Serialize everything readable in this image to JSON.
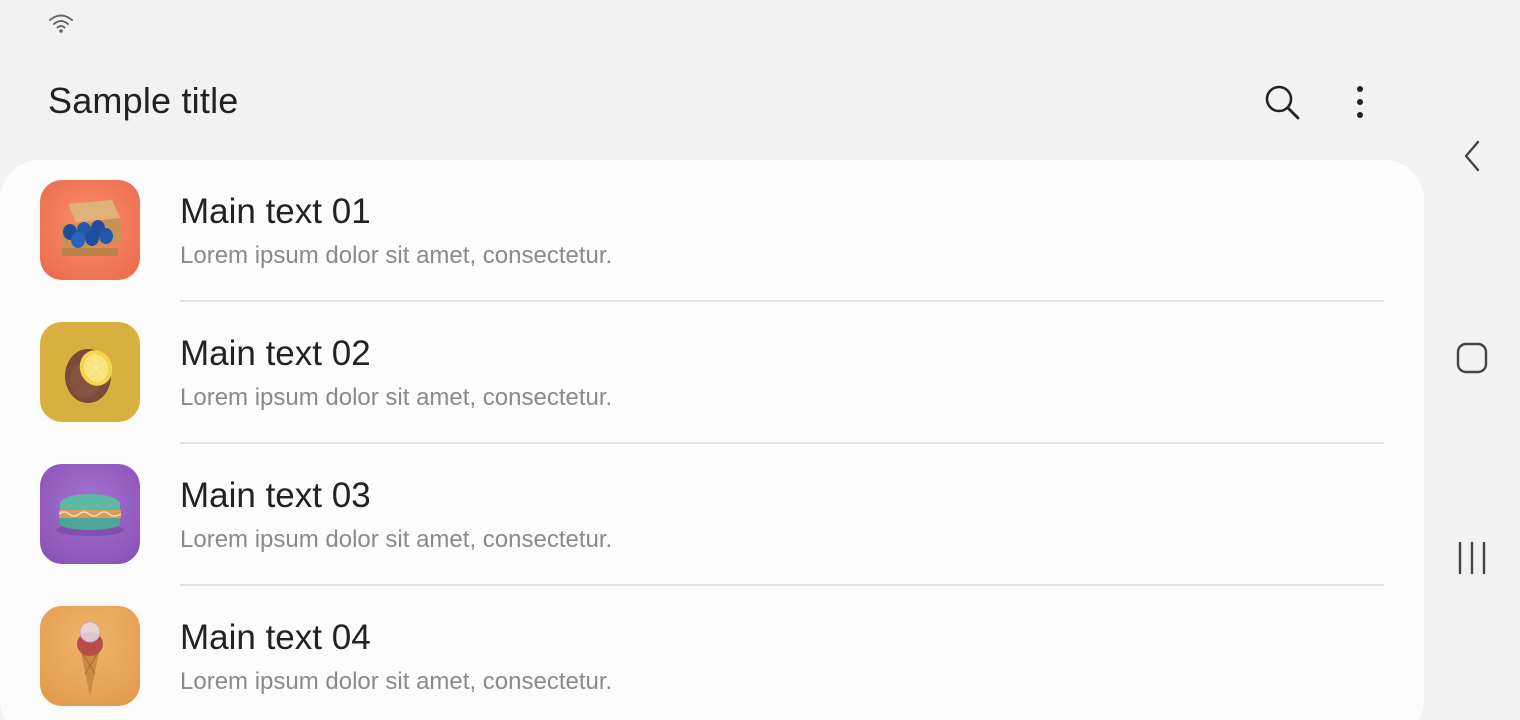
{
  "status_bar": {
    "icons": [
      "wifi-icon"
    ]
  },
  "app_bar": {
    "title": "Sample title",
    "actions": [
      "search-icon",
      "more-options-icon"
    ]
  },
  "list": {
    "items": [
      {
        "main": "Main text 01",
        "sub": "Lorem ipsum dolor sit amet, consectetur.",
        "thumbnail": "egg-carton-thumbnail",
        "thumb_bg": "#f0795a"
      },
      {
        "main": "Main text 02",
        "sub": "Lorem ipsum dolor sit amet, consectetur.",
        "thumbnail": "lemon-kiwi-thumbnail",
        "thumb_bg": "#d7b03f"
      },
      {
        "main": "Main text 03",
        "sub": "Lorem ipsum dolor sit amet, consectetur.",
        "thumbnail": "macaron-thumbnail",
        "thumb_bg": "#9a63c5"
      },
      {
        "main": "Main text 04",
        "sub": "Lorem ipsum dolor sit amet, consectetur.",
        "thumbnail": "ice-cream-cone-thumbnail",
        "thumb_bg": "#e6a55a"
      }
    ]
  },
  "nav_bar": {
    "buttons": [
      "back-icon",
      "home-icon",
      "recents-icon"
    ]
  },
  "colors": {
    "background": "#f2f2f2",
    "card": "#fcfcfc",
    "primary_text": "#222222",
    "secondary_text": "#8a8a8a",
    "divider": "#e4e4e4"
  }
}
